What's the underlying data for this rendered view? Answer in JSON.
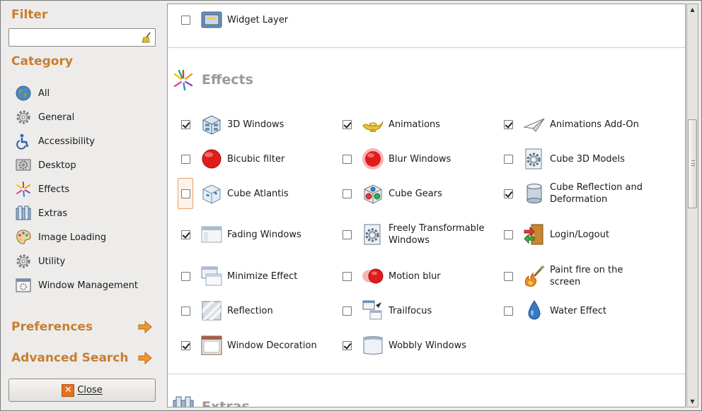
{
  "sidebar": {
    "filter_label": "Filter",
    "filter_value": "",
    "category_label": "Category",
    "categories": [
      {
        "label": "All",
        "icon": "globe-icon"
      },
      {
        "label": "General",
        "icon": "gear-icon"
      },
      {
        "label": "Accessibility",
        "icon": "accessibility-icon"
      },
      {
        "label": "Desktop",
        "icon": "desktop-icon"
      },
      {
        "label": "Effects",
        "icon": "effects-icon"
      },
      {
        "label": "Extras",
        "icon": "extras-icon"
      },
      {
        "label": "Image Loading",
        "icon": "palette-icon"
      },
      {
        "label": "Utility",
        "icon": "gear-icon"
      },
      {
        "label": "Window Management",
        "icon": "window-icon"
      }
    ],
    "preferences_label": "Preferences",
    "advanced_search_label": "Advanced Search",
    "close_label": "Close"
  },
  "main": {
    "top_plugin": {
      "label": "Widget Layer",
      "checked": false,
      "icon": "widget-layer-icon"
    },
    "effects_title": "Effects",
    "extras_title": "Extras",
    "plugins": [
      {
        "label": "3D Windows",
        "checked": true,
        "icon": "3d-windows-icon"
      },
      {
        "label": "Animations",
        "checked": true,
        "icon": "genie-lamp-icon"
      },
      {
        "label": "Animations Add-On",
        "checked": true,
        "icon": "paper-plane-icon"
      },
      {
        "label": "Bicubic filter",
        "checked": false,
        "icon": "red-ball-icon"
      },
      {
        "label": "Blur Windows",
        "checked": false,
        "icon": "blurred-ball-icon"
      },
      {
        "label": "Cube 3D Models",
        "checked": false,
        "icon": "gear-document-icon"
      },
      {
        "label": "Cube Atlantis",
        "checked": false,
        "icon": "cube-atlantis-icon"
      },
      {
        "label": "Cube Gears",
        "checked": false,
        "icon": "cube-gears-icon"
      },
      {
        "label": "Cube Reflection and Deformation",
        "checked": true,
        "icon": "cylinder-icon"
      },
      {
        "label": "Fading Windows",
        "checked": true,
        "icon": "fading-window-icon"
      },
      {
        "label": "Freely Transformable Windows",
        "checked": false,
        "icon": "gear-document-icon"
      },
      {
        "label": "Login/Logout",
        "checked": false,
        "icon": "door-arrows-icon"
      },
      {
        "label": "Minimize Effect",
        "checked": false,
        "icon": "stacked-windows-icon"
      },
      {
        "label": "Motion blur",
        "checked": false,
        "icon": "motion-ball-icon"
      },
      {
        "label": "Paint fire on the screen",
        "checked": false,
        "icon": "fire-brush-icon"
      },
      {
        "label": "Reflection",
        "checked": false,
        "icon": "reflection-icon"
      },
      {
        "label": "Trailfocus",
        "checked": false,
        "icon": "trailfocus-icon"
      },
      {
        "label": "Water Effect",
        "checked": false,
        "icon": "water-drop-icon"
      },
      {
        "label": "Window Decoration",
        "checked": true,
        "icon": "window-decoration-icon"
      },
      {
        "label": "Wobbly Windows",
        "checked": true,
        "icon": "wobbly-window-icon"
      }
    ]
  },
  "colors": {
    "accent": "#c87e2e",
    "section_title": "#9a9a9a"
  }
}
